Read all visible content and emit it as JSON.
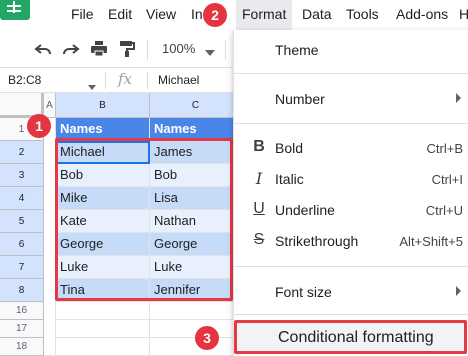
{
  "menubar": {
    "items": [
      "File",
      "Edit",
      "View",
      "In",
      "Format",
      "Data",
      "Tools",
      "Add-ons",
      "H"
    ]
  },
  "toolbar": {
    "zoom": "100%",
    "icons": [
      "undo-icon",
      "redo-icon",
      "print-icon",
      "paint-format-icon"
    ]
  },
  "formula_bar": {
    "name_box": "B2:C8",
    "fx": "fx",
    "value": "Michael"
  },
  "sheet": {
    "columns": [
      "A",
      "B",
      "C"
    ],
    "rows": [
      "1",
      "2",
      "3",
      "4",
      "5",
      "6",
      "7",
      "8",
      "16",
      "17",
      "18"
    ],
    "header": [
      "Names",
      "Names"
    ],
    "data": [
      [
        "Michael",
        "James"
      ],
      [
        "Bob",
        "Bob"
      ],
      [
        "Mike",
        "Lisa"
      ],
      [
        "Kate",
        "Nathan"
      ],
      [
        "George",
        "George"
      ],
      [
        "Luke",
        "Luke"
      ],
      [
        "Tina",
        "Jennifer"
      ]
    ]
  },
  "badges": [
    "1",
    "2",
    "3"
  ],
  "format_menu": {
    "theme": "Theme",
    "number": "Number",
    "bold": "Bold",
    "bold_shortcut": "Ctrl+B",
    "bold_icon": "B",
    "italic": "Italic",
    "italic_shortcut": "Ctrl+I",
    "italic_icon": "I",
    "underline": "Underline",
    "underline_shortcut": "Ctrl+U",
    "underline_icon": "U",
    "strikethrough": "Strikethrough",
    "strikethrough_shortcut": "Alt+Shift+5",
    "strikethrough_icon": "S",
    "font_size": "Font size",
    "conditional_formatting": "Conditional formatting"
  },
  "colors": {
    "header_fill": "#4a86e8",
    "row_fill_dark": "#c6dbf7",
    "row_fill_light": "#e8f0fe",
    "highlight": "#e63946",
    "sheets_green": "#23a566"
  }
}
